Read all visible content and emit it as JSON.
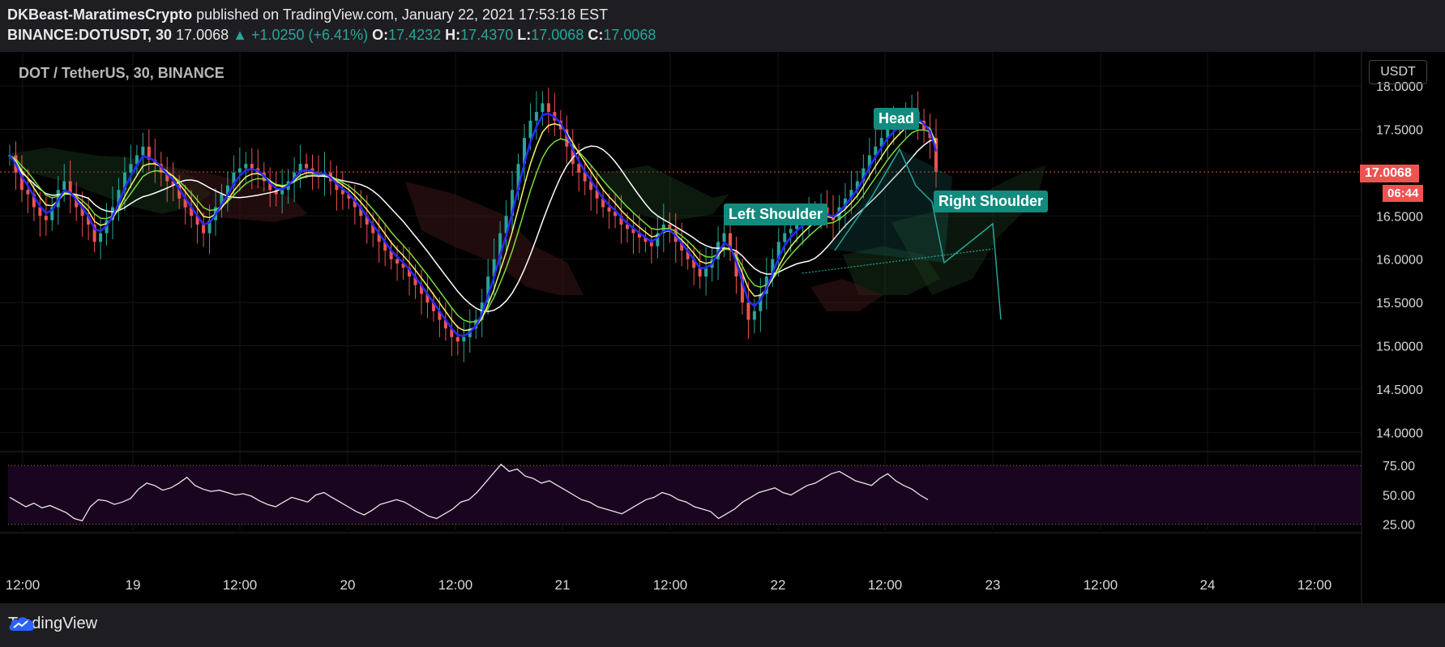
{
  "header": {
    "author": "DKBeast-MaratimesCrypto",
    "published_text": "published on TradingView.com, January 22, 2021 17:53:18 EST",
    "symbol": "BINANCE:DOTUSDT, 30",
    "last": "17.0068",
    "change": "▲ +1.0250 (+6.41%)",
    "o_label": "O:",
    "o": "17.4232",
    "h_label": "H:",
    "h": "17.4370",
    "l_label": "L:",
    "l": "17.0068",
    "c_label": "C:",
    "c": "17.0068"
  },
  "pane": {
    "title": "DOT / TetherUS, 30, BINANCE",
    "currency_button": "USDT",
    "price_tag": "17.0068",
    "countdown": "06:44"
  },
  "annotations": {
    "head": "Head",
    "left_shoulder": "Left Shoulder",
    "right_shoulder": "Right Shoulder"
  },
  "footer": {
    "brand": "TradingView"
  },
  "colors": {
    "up": "#26a69a",
    "down": "#ef5350",
    "background": "#000000",
    "annotation": "#138a7e",
    "ema_blue": "#2a2aff",
    "ema_yellow": "#f5f56a",
    "ema_green": "#7cdc3a",
    "ema_white": "#ffffff",
    "rsi_band": "#1a0520"
  },
  "chart_data": [
    {
      "type": "candlestick",
      "symbol": "DOT / TetherUS",
      "interval": "30",
      "y_axis_ticks": [
        "18.0000",
        "17.5000",
        "16.5000",
        "16.0000",
        "15.5000",
        "15.0000",
        "14.5000",
        "14.0000"
      ],
      "ylim": [
        13.9,
        18.3
      ],
      "x_axis_ticks": [
        "12:00",
        "19",
        "12:00",
        "20",
        "12:00",
        "21",
        "12:00",
        "22",
        "12:00",
        "23",
        "12:00",
        "24",
        "12:00"
      ],
      "last_price": 17.0068,
      "closes": [
        17.2,
        17.0,
        16.8,
        16.75,
        16.6,
        16.5,
        16.45,
        16.6,
        16.8,
        16.9,
        16.75,
        16.6,
        16.5,
        16.4,
        16.2,
        16.3,
        16.45,
        16.6,
        16.8,
        17.0,
        17.1,
        17.2,
        17.3,
        17.15,
        17.1,
        17.0,
        16.9,
        16.85,
        16.7,
        16.6,
        16.5,
        16.4,
        16.3,
        16.45,
        16.6,
        16.75,
        16.85,
        17.0,
        17.05,
        17.1,
        17.05,
        17.0,
        16.9,
        16.8,
        16.75,
        16.8,
        16.9,
        17.0,
        17.1,
        17.05,
        17.0,
        16.95,
        17.0,
        16.9,
        16.8,
        16.75,
        16.7,
        16.6,
        16.5,
        16.4,
        16.3,
        16.2,
        16.1,
        16.0,
        15.95,
        15.9,
        15.8,
        15.7,
        15.6,
        15.5,
        15.4,
        15.3,
        15.2,
        15.1,
        15.05,
        15.1,
        15.2,
        15.3,
        15.5,
        15.8,
        16.0,
        16.3,
        16.5,
        16.8,
        17.1,
        17.4,
        17.6,
        17.7,
        17.8,
        17.7,
        17.6,
        17.5,
        17.3,
        17.1,
        17.0,
        16.9,
        16.8,
        16.7,
        16.6,
        16.55,
        16.5,
        16.4,
        16.35,
        16.3,
        16.25,
        16.2,
        16.15,
        16.3,
        16.4,
        16.35,
        16.2,
        16.1,
        16.0,
        15.9,
        15.8,
        15.9,
        16.0,
        16.2,
        16.3,
        16.1,
        15.8,
        15.5,
        15.3,
        15.4,
        15.6,
        15.8,
        16.0,
        16.2,
        16.3,
        16.35,
        16.4,
        16.45,
        16.5,
        16.55,
        16.6,
        16.5,
        16.45,
        16.6,
        16.7,
        16.8,
        16.9,
        17.05,
        17.2,
        17.3,
        17.4,
        17.5,
        17.55,
        17.6,
        17.65,
        17.7,
        17.6,
        17.5,
        17.4,
        17.0068
      ],
      "rsi": {
        "levels": [
          "75.00",
          "50.00",
          "25.00"
        ],
        "ylim": [
          20,
          82
        ],
        "values": [
          48,
          44,
          40,
          43,
          39,
          41,
          38,
          35,
          30,
          28,
          40,
          46,
          45,
          42,
          44,
          47,
          55,
          60,
          58,
          54,
          56,
          60,
          65,
          58,
          55,
          53,
          54,
          52,
          50,
          51,
          49,
          45,
          42,
          40,
          44,
          48,
          46,
          44,
          50,
          52,
          48,
          44,
          40,
          36,
          33,
          37,
          42,
          44,
          46,
          44,
          40,
          36,
          32,
          30,
          34,
          38,
          44,
          46,
          52,
          60,
          68,
          76,
          70,
          72,
          66,
          64,
          60,
          62,
          58,
          54,
          50,
          46,
          44,
          40,
          38,
          36,
          34,
          38,
          42,
          46,
          48,
          52,
          50,
          46,
          44,
          40,
          38,
          36,
          30,
          34,
          38,
          44,
          48,
          52,
          54,
          56,
          52,
          50,
          54,
          58,
          60,
          64,
          68,
          70,
          66,
          62,
          60,
          58,
          64,
          68,
          62,
          58,
          55,
          50,
          46
        ]
      }
    }
  ]
}
